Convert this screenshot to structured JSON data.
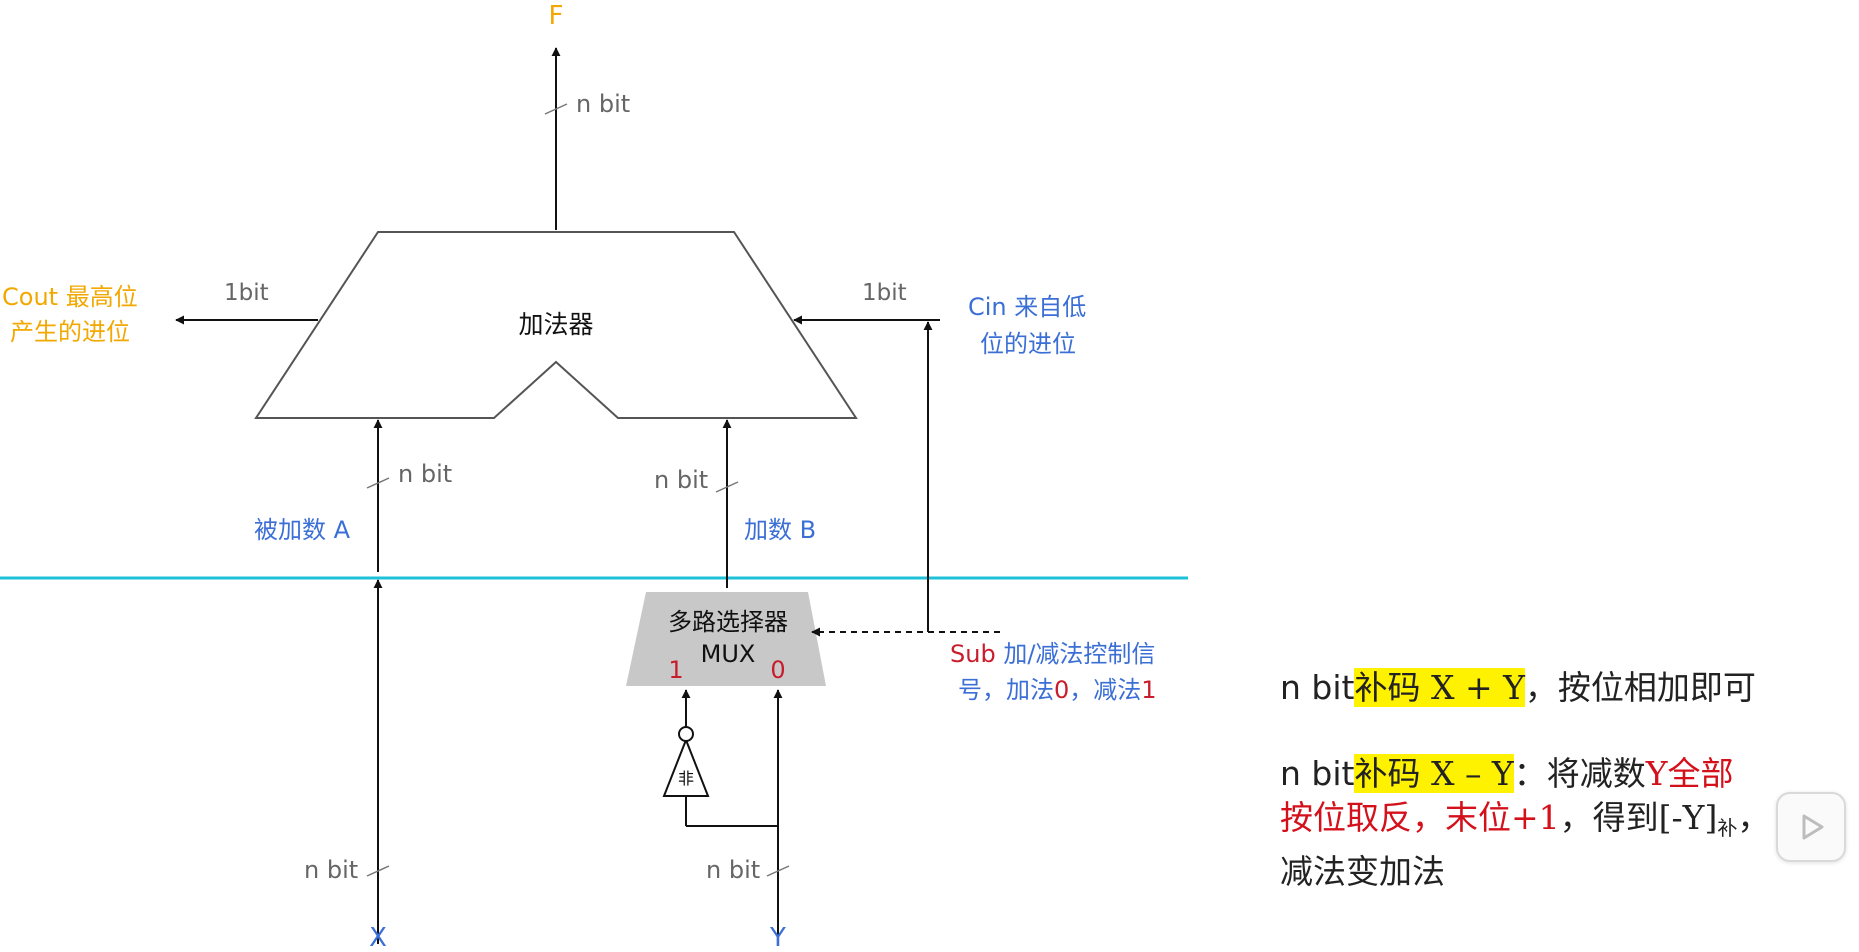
{
  "diagram": {
    "output_label": "F",
    "output_width": "n bit",
    "adder_label": "加法器",
    "cout_width": "1bit",
    "cout_label_line1": "Cout 最高位",
    "cout_label_line2": "产生的进位",
    "cin_width": "1bit",
    "cin_label_line1": "Cin 来自低",
    "cin_label_line2": "位的进位",
    "a_width": "n bit",
    "a_label": "被加数 A",
    "b_width": "n bit",
    "b_label": "加数 B",
    "mux_title": "多路选择器",
    "mux_sub": "MUX",
    "mux_in1": "1",
    "mux_in0": "0",
    "not_gate": "非",
    "sub_word": "Sub",
    "sub_desc_line1": " 加/减法控制信",
    "sub_desc_line2a": "号，加法",
    "sub_desc_zero": "0",
    "sub_desc_line2b": "，减法",
    "sub_desc_one": "1",
    "x_width": "n bit",
    "x_label": "X",
    "y_width": "n bit",
    "y_label": "Y",
    "colors": {
      "orange": "#f2a800",
      "blue": "#3b6fd6",
      "red": "#c81d2b",
      "cyan": "#1ec1d8",
      "gray_text": "#666666",
      "mux_fill": "#c8c8c8"
    }
  },
  "notes": {
    "line1_prefix": "n bit",
    "line1_hl": "补码 X + Y",
    "line1_suffix": "，按位相加即可",
    "line2_prefix": "n bit",
    "line2_hl": "补码 X – Y",
    "line2_mid": "：将减数",
    "line2_red": "Y全部",
    "line3_red": "按位取反，末位+1",
    "line3_mid": "，得到[-Y]",
    "line3_sub": "补",
    "line3_end": "，",
    "line4": "减法变加法"
  },
  "player": {
    "icon": "play-icon"
  }
}
